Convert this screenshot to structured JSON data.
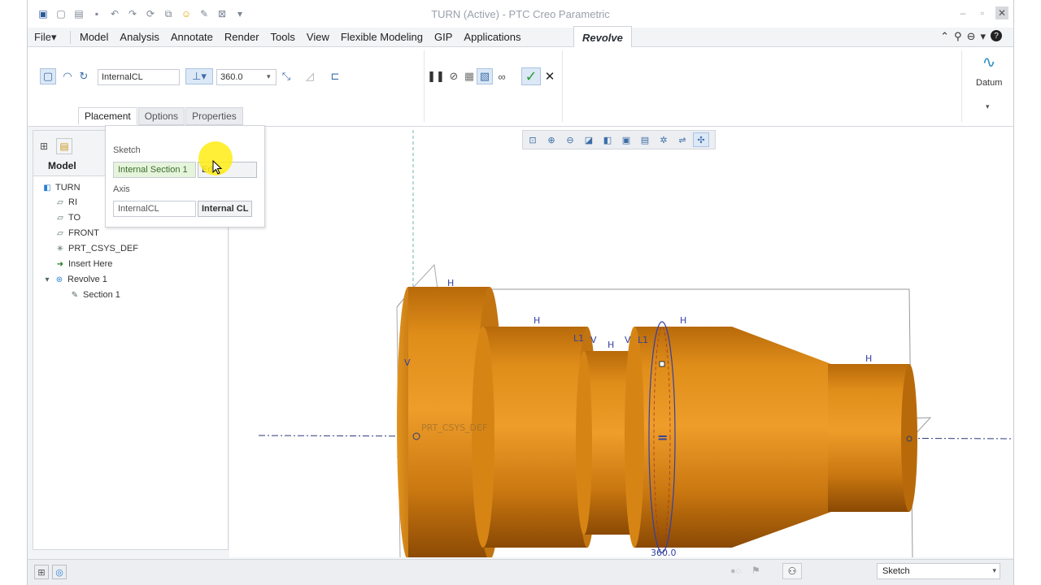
{
  "window": {
    "title": "TURN (Active) - PTC Creo Parametric"
  },
  "menubar": {
    "file": "File",
    "items": [
      "Model",
      "Analysis",
      "Annotate",
      "Render",
      "Tools",
      "View",
      "Flexible Modeling",
      "GIP",
      "Applications"
    ],
    "active_tab": "Revolve"
  },
  "ribbon": {
    "axis_field": "InternalCL",
    "angle_value": "360.0",
    "datum_label": "Datum"
  },
  "dashboard_tabs": [
    "Placement",
    "Options",
    "Properties"
  ],
  "placement_panel": {
    "sketch_label": "Sketch",
    "sketch_value": "Internal Section 1",
    "edit_button": "Edit...",
    "axis_label": "Axis",
    "axis_value": "InternalCL",
    "axis_button": "Internal CL"
  },
  "model_tree": {
    "tab_label": "Model",
    "items": [
      {
        "label": "TURN",
        "icon": "part-icon"
      },
      {
        "label": "RI",
        "icon": "datum-plane-icon"
      },
      {
        "label": "TO",
        "icon": "datum-plane-icon"
      },
      {
        "label": "FRONT",
        "icon": "datum-plane-icon"
      },
      {
        "label": "PRT_CSYS_DEF",
        "icon": "csys-icon"
      },
      {
        "label": "Insert Here",
        "icon": "insert-arrow-icon"
      },
      {
        "label": "Revolve 1",
        "icon": "revolve-icon"
      },
      {
        "label": "Section 1",
        "icon": "sketch-icon"
      }
    ]
  },
  "viewport": {
    "csys_label": "PRT_CSYS_DEF",
    "angle_dim": "360.0",
    "constraint_labels": [
      "H",
      "H",
      "H",
      "H",
      "H",
      "V",
      "L1",
      "L1",
      "V",
      "V"
    ]
  },
  "statusbar": {
    "filter_value": "Sketch"
  },
  "colors": {
    "part": "#d98512",
    "part_dark": "#8f4d05",
    "accent_blue": "#3b6ea8",
    "ok_green": "#2e9b3a"
  }
}
